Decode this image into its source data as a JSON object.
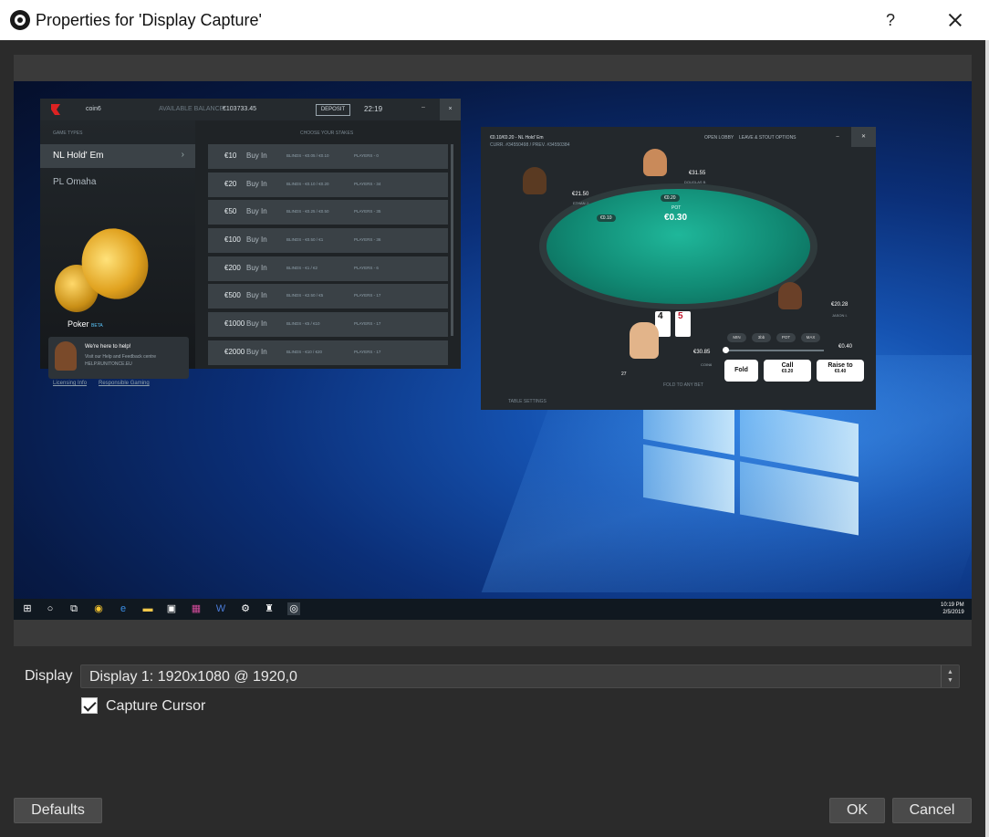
{
  "window": {
    "title": "Properties for 'Display Capture'",
    "help_glyph": "?",
    "close_glyph": "✕"
  },
  "preview": {
    "lobby": {
      "username": "coin6",
      "balance_label": "AVAILABLE BALANCE:",
      "balance": "€103733.45",
      "deposit": "DEPOSIT",
      "time": "22:19",
      "minimize": "–",
      "close": "×",
      "game_types_header": "GAME TYPES",
      "game_types": [
        "NL Hold' Em",
        "PL Omaha"
      ],
      "stakes_header": "CHOOSE YOUR STAKES",
      "stakes": [
        {
          "amount": "€10",
          "buy": "Buy In",
          "blinds": "BLINDS - €0.05 / €0.10",
          "players": "PLAYERS - 0"
        },
        {
          "amount": "€20",
          "buy": "Buy In",
          "blinds": "BLINDS - €0.10 / €0.20",
          "players": "PLAYERS - 34"
        },
        {
          "amount": "€50",
          "buy": "Buy In",
          "blinds": "BLINDS - €0.25 / €0.50",
          "players": "PLAYERS - 35"
        },
        {
          "amount": "€100",
          "buy": "Buy In",
          "blinds": "BLINDS - €0.50 / €1",
          "players": "PLAYERS - 36"
        },
        {
          "amount": "€200",
          "buy": "Buy In",
          "blinds": "BLINDS - €1 / €2",
          "players": "PLAYERS - 6"
        },
        {
          "amount": "€500",
          "buy": "Buy In",
          "blinds": "BLINDS - €2.50 / €5",
          "players": "PLAYERS - 17"
        },
        {
          "amount": "€1000",
          "buy": "Buy In",
          "blinds": "BLINDS - €5 / €10",
          "players": "PLAYERS - 17"
        },
        {
          "amount": "€2000",
          "buy": "Buy In",
          "blinds": "BLINDS - €10 / €20",
          "players": "PLAYERS - 17"
        }
      ],
      "brand": "Poker",
      "brand_tag": "BETA",
      "help_title": "We're here to help!",
      "help_line1": "Visit our Help and Feedback centre",
      "help_line2": "HELP.RUNITONCE.EU",
      "link_licensing": "Licensing Info",
      "link_responsible": "Responsible Gaming"
    },
    "table": {
      "title": "€0.10/€0.20 - NL Hold' Em",
      "subtitle": "CURR. #34550498 / PREV. #34550384",
      "open_lobby": "OPEN LOBBY",
      "leave": "LEAVE & STOUT OPTIONS",
      "minimize": "–",
      "close": "✕",
      "pot_label": "POT",
      "pot": "€0.30",
      "bet_top": "€0.20",
      "bet_left": "€0.10",
      "seat_left_amt": "€21.50",
      "seat_left_name": "ETHAN J.",
      "seat_top_amt": "€31.55",
      "seat_top_name": "DOUGLAS B.",
      "seat_right_amt": "€20.28",
      "seat_right_name": "JASON I.",
      "hero_amt": "€30.85",
      "hero_name": "COIN6",
      "hero_level": "27",
      "card1": "4",
      "card2": "5",
      "bet_buttons": [
        "MIN",
        "3bb",
        "POT",
        "MAX"
      ],
      "slider_value": "€0.40",
      "fold": "Fold",
      "call": "Call",
      "call_amt": "€0.20",
      "raise": "Raise to",
      "raise_amt": "€0.40",
      "fold_any": "FOLD TO ANY BET",
      "table_settings": "TABLE SETTINGS"
    },
    "taskbar": {
      "clock_time": "10:19 PM",
      "clock_date": "2/5/2019"
    }
  },
  "controls": {
    "display_label": "Display",
    "display_value": "Display 1: 1920x1080 @ 1920,0",
    "capture_cursor_label": "Capture Cursor",
    "capture_cursor_checked": true
  },
  "buttons": {
    "defaults": "Defaults",
    "ok": "OK",
    "cancel": "Cancel"
  }
}
